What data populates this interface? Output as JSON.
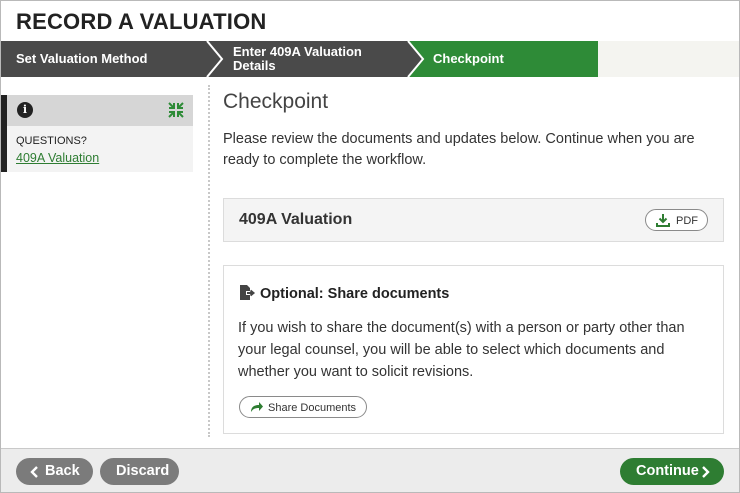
{
  "app": {
    "title": "RECORD A VALUATION"
  },
  "steps": [
    {
      "label": "Set Valuation Method",
      "state": "completed"
    },
    {
      "label_line1": "Enter 409A Valuation",
      "label_line2": "Details",
      "state": "completed"
    },
    {
      "label": "Checkpoint",
      "state": "current"
    }
  ],
  "sidebar": {
    "info_icon": "info-icon",
    "collapse_icon": "collapse-icon",
    "questions_label": "QUESTIONS?",
    "link": "409A Valuation"
  },
  "main": {
    "heading": "Checkpoint",
    "intro": "Please review the documents and updates below. Continue when you are ready to complete the workflow.",
    "document": {
      "title": "409A Valuation",
      "pdf_label": "PDF",
      "pdf_icon": "download-icon"
    },
    "share": {
      "icon": "share-document-icon",
      "title": "Optional: Share documents",
      "text": "If you wish to share the document(s) with a person or party other than your legal counsel, you will be able to select which documents and whether you want to solicit revisions.",
      "button_label": "Share Documents",
      "button_icon": "share-arrow-icon"
    }
  },
  "footer": {
    "back_label": "Back",
    "discard_label": "Discard",
    "continue_label": "Continue"
  },
  "colors": {
    "step_completed": "#4a4a4a",
    "step_current": "#2e8b37",
    "step_upcoming": "#f2f2f2",
    "accent_green": "#2e7d32",
    "button_gray": "#7b7b7b"
  }
}
